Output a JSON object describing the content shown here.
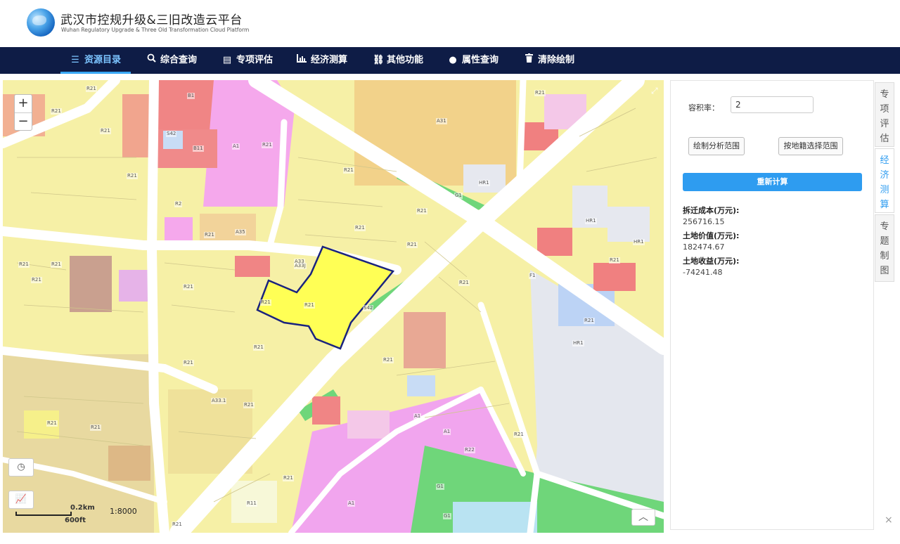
{
  "header": {
    "title_cn": "武汉市控规升级&三旧改造云平台",
    "title_en": "Wuhan Regulatory Upgrade & Three Old Transformation Cloud Platform"
  },
  "nav": {
    "items": [
      {
        "label": "资源目录",
        "icon": "list-icon",
        "active": true
      },
      {
        "label": "综合查询",
        "icon": "search-icon",
        "active": false
      },
      {
        "label": "专项评估",
        "icon": "document-icon",
        "active": false
      },
      {
        "label": "经济测算",
        "icon": "chart-icon",
        "active": false
      },
      {
        "label": "其他功能",
        "icon": "link-icon",
        "active": false
      },
      {
        "label": "属性查询",
        "icon": "circle-icon",
        "active": false
      },
      {
        "label": "清除绘制",
        "icon": "trash-icon",
        "active": false
      }
    ]
  },
  "map": {
    "zoom_in": "+",
    "zoom_out": "−",
    "scale_km": "0.2km",
    "scale_ft": "600ft",
    "scale_ratio": "1:8000",
    "colors": {
      "residential": "#f6f08a",
      "commercial": "#f7b0e6",
      "public": "#f5a3a3",
      "green": "#6fd67a",
      "road": "#ffffff",
      "selected": "#ffff55",
      "selected_outline": "#1a237e"
    },
    "labels": [
      "R21",
      "R21",
      "B1",
      "A1",
      "R21",
      "A31",
      "R21",
      "B11",
      "S42",
      "R21",
      "R21",
      "A33",
      "R21",
      "R2",
      "A35",
      "R21",
      "R21",
      "G1",
      "R21",
      "R21",
      "R21",
      "R21",
      "A33J",
      "R21",
      "R21",
      "R21",
      "R21",
      "S42",
      "R21",
      "F1",
      "R21",
      "R21",
      "R21",
      "R21",
      "R21",
      "A33.1",
      "R21",
      "A1",
      "A1",
      "R22",
      "R21",
      "R21",
      "G1",
      "A1",
      "G1",
      "R11",
      "R21",
      "R21",
      "R21",
      "HR1",
      "HR1",
      "HR1",
      "HR1"
    ]
  },
  "panel": {
    "far_label": "容积率：",
    "far_value": "2",
    "btn_draw": "绘制分析范围",
    "btn_parcel": "按地籍选择范围",
    "btn_recalc": "重新计算",
    "results": [
      {
        "label": "拆迁成本(万元):",
        "value": "256716.15"
      },
      {
        "label": "土地价值(万元):",
        "value": "182474.67"
      },
      {
        "label": "土地收益(万元):",
        "value": "-74241.48"
      }
    ]
  },
  "side_tabs": [
    {
      "label": "专项评估",
      "active": false
    },
    {
      "label": "经济测算",
      "active": true
    },
    {
      "label": "专题制图",
      "active": false
    }
  ],
  "close": "×"
}
